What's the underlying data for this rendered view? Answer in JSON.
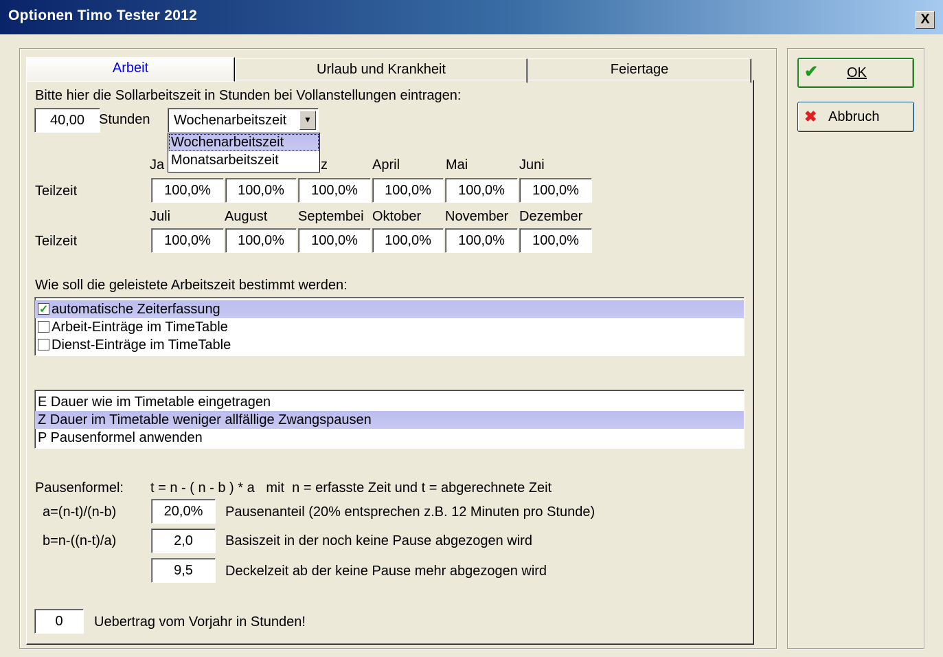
{
  "window": {
    "title": "Optionen Timo Tester 2012",
    "close_label": "X"
  },
  "tabs": [
    "Arbeit",
    "Urlaub und Krankheit",
    "Feiertage"
  ],
  "work": {
    "intro": "Bitte hier die Sollarbeitszeit in Stunden bei Vollanstellungen eintragen:",
    "hours_value": "40,00",
    "hours_unit": "Stunden",
    "mode_selected": "Wochenarbeitszeit",
    "mode_options": [
      "Wochenarbeitszeit",
      "Monatsarbeitszeit"
    ],
    "months_row1": [
      "Ja",
      "z",
      "April",
      "Mai",
      "Juni"
    ],
    "months_row2": [
      "Juli",
      "August",
      "Septembei",
      "Oktober",
      "November",
      "Dezember"
    ],
    "row_label": "Teilzeit",
    "row1_values": [
      "100,0%",
      "100,0%",
      "100,0%",
      "100,0%",
      "100,0%",
      "100,0%"
    ],
    "row2_values": [
      "100,0%",
      "100,0%",
      "100,0%",
      "100,0%",
      "100,0%",
      "100,0%"
    ]
  },
  "determination": {
    "question": "Wie soll die geleistete Arbeitszeit bestimmt werden:",
    "options": [
      {
        "label": "automatische Zeiterfassung",
        "checked": true
      },
      {
        "label": "Arbeit-Einträge im TimeTable",
        "checked": false
      },
      {
        "label": "Dienst-Einträge im TimeTable",
        "checked": false
      }
    ]
  },
  "duration_list": [
    "E Dauer wie im Timetable eingetragen",
    "Z Dauer im Timetable weniger allfällige Zwangspausen",
    "P Pausenformel anwenden"
  ],
  "formula": {
    "label": "Pausenformel:",
    "text": "t = n - ( n - b ) * a   mit  n = erfasste Zeit und t = abgerechnete Zeit",
    "a_label": "a=(n-t)/(n-b)",
    "a_value": "20,0%",
    "a_desc": "Pausenanteil (20% entsprechen z.B. 12 Minuten pro Stunde)",
    "b_label": "b=n-((n-t)/a)",
    "b_value": "2,0",
    "b_desc": "Basiszeit in der noch keine Pause abgezogen wird",
    "c_value": "9,5",
    "c_desc": "Deckelzeit ab der keine Pause mehr abgezogen wird"
  },
  "carryover": {
    "value": "0",
    "label": "Uebertrag vom Vorjahr in Stunden!"
  },
  "buttons": {
    "ok": "OK",
    "cancel": "Abbruch"
  },
  "colors": {
    "title_start": "#0a246a",
    "title_end": "#a6caf0",
    "selection": "#c0c0f0",
    "active_tab_text": "#0000ff"
  },
  "icons": {
    "ok": "checkmark-icon",
    "cancel": "red-x-icon"
  }
}
